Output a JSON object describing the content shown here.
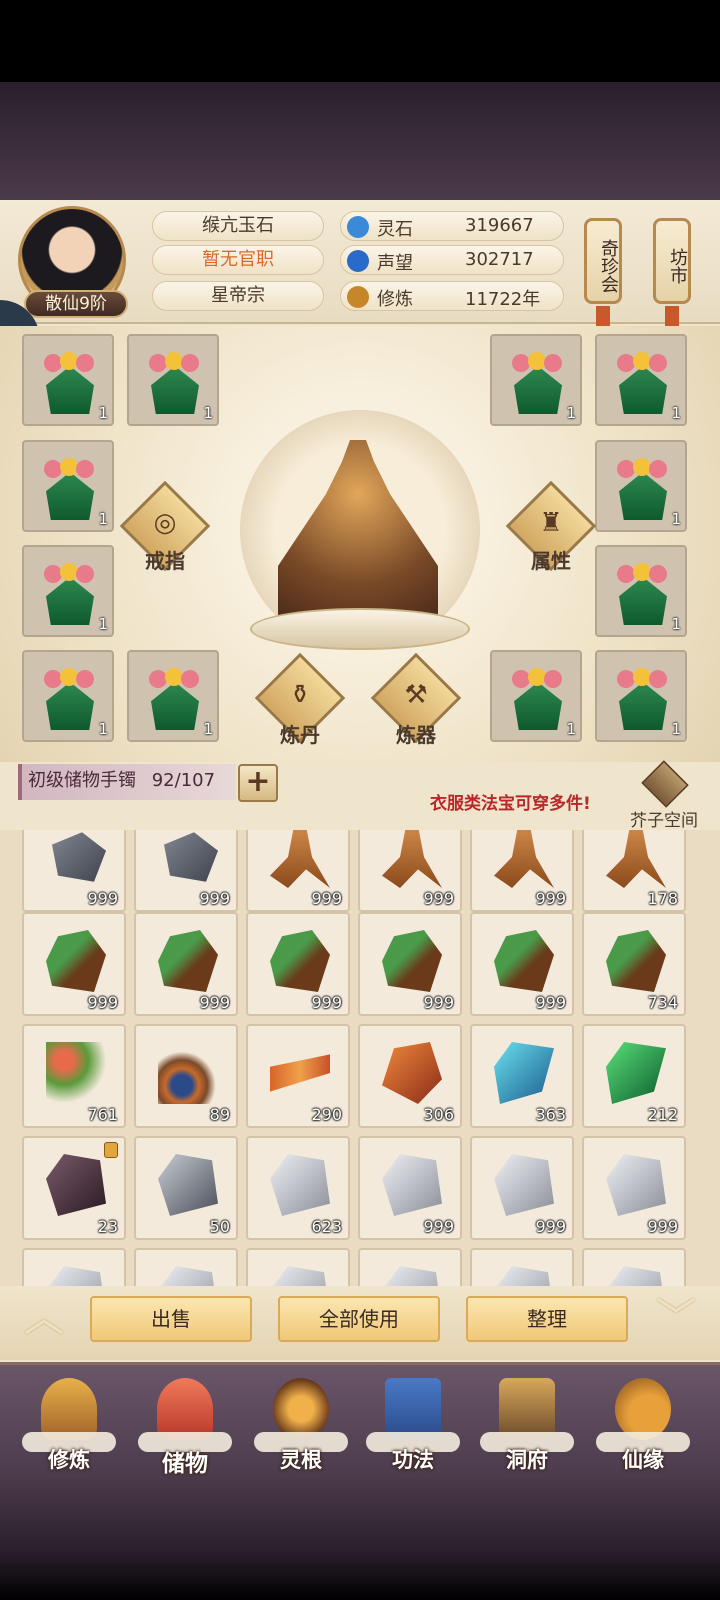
{
  "header": {
    "rank": "散仙9阶",
    "info": [
      "缑亢玉石",
      "暂无官职",
      "星帝宗"
    ],
    "stats": [
      {
        "label": "灵石",
        "value": "319667",
        "icon": "spirit-stone-icon",
        "color": "#3a8ad8"
      },
      {
        "label": "声望",
        "value": "302717",
        "icon": "reputation-icon",
        "color": "#2a6ac8"
      },
      {
        "label": "修炼",
        "value": "11722年",
        "icon": "meditation-icon",
        "color": "#c8862a"
      }
    ],
    "buttons": {
      "treasure": "奇珍会",
      "market": "坊市"
    }
  },
  "equip": {
    "ring_label": "戒指",
    "attr_label": "属性",
    "alchemy_label": "炼丹",
    "forge_label": "炼器",
    "slot_count": "1"
  },
  "bag": {
    "name": "初级储物手镯",
    "capacity": "92/107",
    "hint": "衣服类法宝可穿多件!",
    "space_label": "芥子空间",
    "items": [
      {
        "count": "999",
        "kind": "iron"
      },
      {
        "count": "999",
        "kind": "iron"
      },
      {
        "count": "999",
        "kind": "root"
      },
      {
        "count": "999",
        "kind": "root"
      },
      {
        "count": "999",
        "kind": "root"
      },
      {
        "count": "178",
        "kind": "root"
      },
      {
        "count": "999",
        "kind": "herb"
      },
      {
        "count": "999",
        "kind": "herb"
      },
      {
        "count": "999",
        "kind": "herb"
      },
      {
        "count": "999",
        "kind": "herb"
      },
      {
        "count": "999",
        "kind": "herb"
      },
      {
        "count": "734",
        "kind": "herb"
      },
      {
        "count": "761",
        "kind": "flower"
      },
      {
        "count": "89",
        "kind": "berry"
      },
      {
        "count": "290",
        "kind": "worm"
      },
      {
        "count": "306",
        "kind": "red-crystal"
      },
      {
        "count": "363",
        "kind": "blue-crystal"
      },
      {
        "count": "212",
        "kind": "green-crystal"
      },
      {
        "count": "23",
        "kind": "dark-ore"
      },
      {
        "count": "50",
        "kind": "grey-ore"
      },
      {
        "count": "623",
        "kind": "silver-ore"
      },
      {
        "count": "999",
        "kind": "silver-ore"
      },
      {
        "count": "999",
        "kind": "silver-ore"
      },
      {
        "count": "999",
        "kind": "silver-ore"
      },
      {
        "count": "",
        "kind": "silver-ore"
      },
      {
        "count": "",
        "kind": "silver-ore"
      },
      {
        "count": "",
        "kind": "silver-ore"
      },
      {
        "count": "",
        "kind": "silver-ore"
      },
      {
        "count": "",
        "kind": "silver-ore"
      },
      {
        "count": "",
        "kind": "silver-ore"
      }
    ]
  },
  "actions": {
    "sell": "出售",
    "use_all": "全部使用",
    "sort": "整理"
  },
  "nav": [
    "修炼",
    "储物",
    "灵根",
    "功法",
    "洞府",
    "仙缘"
  ],
  "colors": {
    "robe": "#1f7a42",
    "red_crystal": "#c84a2a",
    "blue_crystal": "#2aa6c8",
    "green_crystal": "#22a050",
    "dark_ore": "#4a2a3a",
    "silver_ore": "#b8bcc4"
  }
}
